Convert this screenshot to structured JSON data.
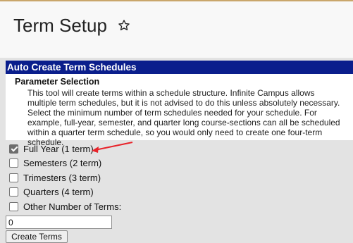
{
  "page": {
    "title": "Term Setup"
  },
  "section": {
    "header": "Auto Create Term Schedules",
    "parameter_title": "Parameter Selection",
    "description": "This tool will create terms within a schedule structure. Infinite Campus allows multiple term schedules, but it is not advised to do this unless absolutely necessary. Select the minimum number of term schedules needed for your schedule. For example, full-year, semester, and quarter long course-sections can all be scheduled within a quarter term schedule, so you would only need to create one four-term schedule."
  },
  "options": [
    {
      "label": "Full Year (1 term)",
      "checked": true
    },
    {
      "label": "Semesters (2 term)",
      "checked": false
    },
    {
      "label": "Trimesters (3 term)",
      "checked": false
    },
    {
      "label": "Quarters (4 term)",
      "checked": false
    },
    {
      "label": "Other Number of Terms:",
      "checked": false
    }
  ],
  "other_terms": {
    "value": "0"
  },
  "actions": {
    "create_label": "Create Terms"
  },
  "colors": {
    "header_bg": "#0a1e8c",
    "annotation_arrow": "#e8232a"
  },
  "icons": {
    "favorite": "star-outline-icon"
  }
}
